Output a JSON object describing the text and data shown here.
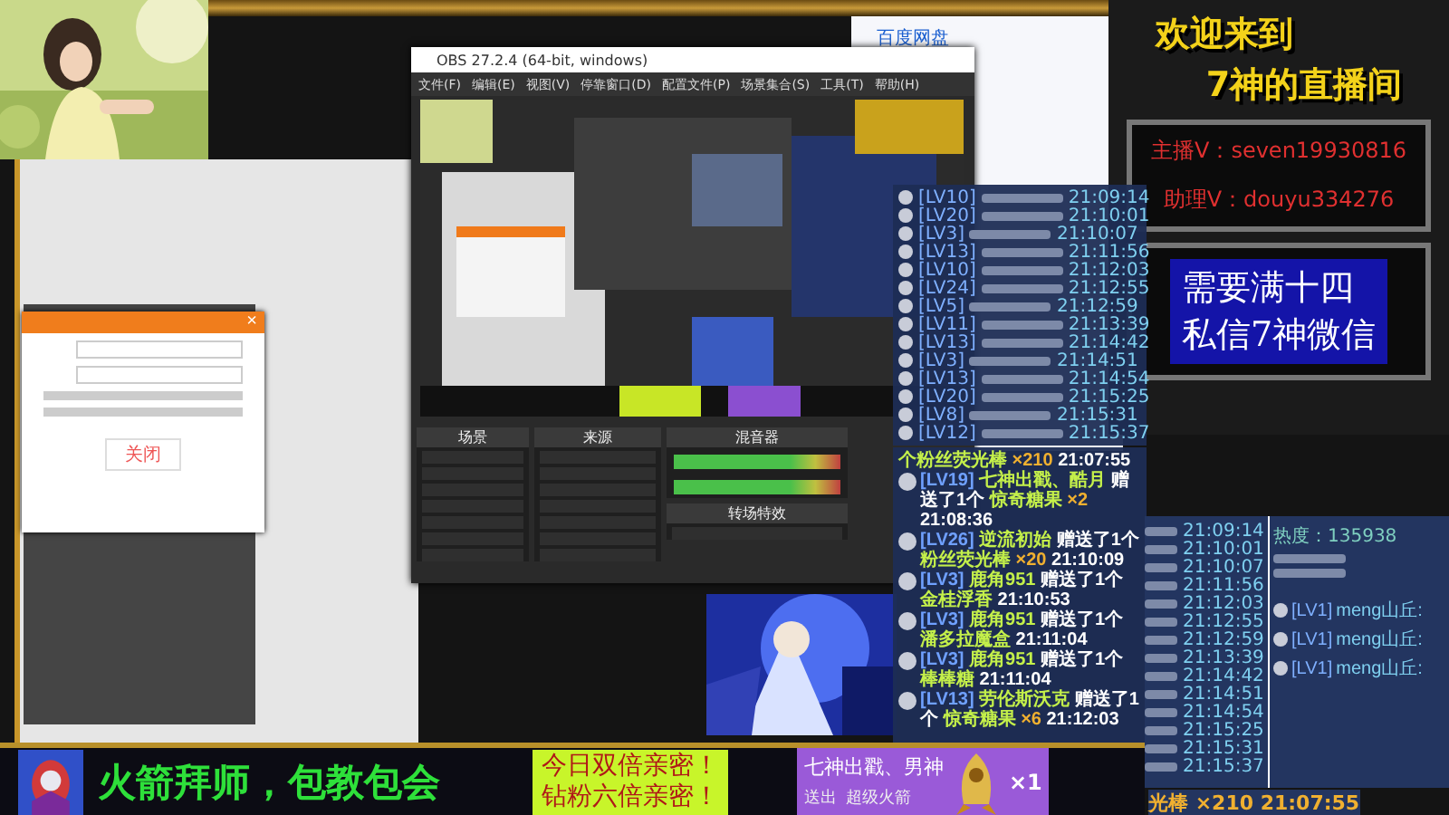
{
  "stream_overlay": {
    "welcome_title": [
      "欢迎来到",
      "7神的直播间"
    ],
    "contact_lines": [
      "主播V：seven19930816",
      "助理V：douyu334276"
    ],
    "notice_lines": [
      "需要满十四",
      "私信7神微信"
    ],
    "bottom_slogan": "火箭拜师，包教包会",
    "promo_lines": [
      "今日双倍亲密！",
      "钻粉六倍亲密！"
    ],
    "gift_toast": {
      "sender": "七神出戳、男神",
      "action": "送出",
      "gift": "超级火箭",
      "count": "×1"
    }
  },
  "browser_dialog": {
    "close": "×",
    "button": "关闭"
  },
  "netdisk_window": {
    "title": "百度网盘"
  },
  "obs_window": {
    "title": "OBS 27.2.4 (64-bit, windows)",
    "menu": [
      "文件(F)",
      "编辑(E)",
      "视图(V)",
      "停靠窗口(D)",
      "配置文件(P)",
      "场景集合(S)",
      "工具(T)",
      "帮助(H)"
    ],
    "docks": [
      "场景",
      "来源",
      "混音器",
      "转场特效"
    ]
  },
  "entry_chat": {
    "entries": [
      {
        "level": "[LV10]",
        "time": "21:09:14"
      },
      {
        "level": "[LV20]",
        "time": "21:10:01"
      },
      {
        "level": "[LV3]",
        "time": "21:10:07"
      },
      {
        "level": "[LV13]",
        "time": "21:11:56"
      },
      {
        "level": "[LV10]",
        "time": "21:12:03"
      },
      {
        "level": "[LV24]",
        "time": "21:12:55"
      },
      {
        "level": "[LV5]",
        "time": "21:12:59"
      },
      {
        "level": "[LV11]",
        "time": "21:13:39"
      },
      {
        "level": "[LV13]",
        "time": "21:14:42"
      },
      {
        "level": "[LV3]",
        "time": "21:14:51"
      },
      {
        "level": "[LV13]",
        "time": "21:14:54"
      },
      {
        "level": "[LV20]",
        "time": "21:15:25"
      },
      {
        "level": "[LV8]",
        "time": "21:15:31"
      },
      {
        "level": "[LV12]",
        "time": "21:15:37"
      }
    ]
  },
  "gift_chat": {
    "messages": [
      {
        "segments": [
          {
            "kind": "gift",
            "text": "个粉丝荧光棒"
          },
          {
            "kind": "count",
            "text": "×210"
          },
          {
            "kind": "time",
            "text": "21:07:55"
          }
        ]
      },
      {
        "segments": [
          {
            "kind": "level",
            "text": "[LV19]"
          },
          {
            "kind": "user",
            "text": "七神出戳、酷月"
          },
          {
            "kind": "plain",
            "text": "赠送了1个"
          },
          {
            "kind": "gift",
            "text": "惊奇糖果"
          },
          {
            "kind": "count",
            "text": "×2"
          },
          {
            "kind": "time",
            "text": "21:08:36"
          }
        ]
      },
      {
        "segments": [
          {
            "kind": "level",
            "text": "[LV26]"
          },
          {
            "kind": "user",
            "text": "逆流初始"
          },
          {
            "kind": "plain",
            "text": "赠送了1个"
          },
          {
            "kind": "gift",
            "text": "粉丝荧光棒"
          },
          {
            "kind": "count",
            "text": "×20"
          },
          {
            "kind": "time",
            "text": "21:10:09"
          }
        ]
      },
      {
        "segments": [
          {
            "kind": "level",
            "text": "[LV3]"
          },
          {
            "kind": "user",
            "text": "鹿角951"
          },
          {
            "kind": "plain",
            "text": "赠送了1个"
          },
          {
            "kind": "gift",
            "text": "金桂浮香"
          },
          {
            "kind": "time",
            "text": "21:10:53"
          }
        ]
      },
      {
        "segments": [
          {
            "kind": "level",
            "text": "[LV3]"
          },
          {
            "kind": "user",
            "text": "鹿角951"
          },
          {
            "kind": "plain",
            "text": "赠送了1个"
          },
          {
            "kind": "gift",
            "text": "潘多拉魔盒"
          },
          {
            "kind": "time",
            "text": "21:11:04"
          }
        ]
      },
      {
        "segments": [
          {
            "kind": "level",
            "text": "[LV3]"
          },
          {
            "kind": "user",
            "text": "鹿角951"
          },
          {
            "kind": "plain",
            "text": "赠送了1个"
          },
          {
            "kind": "gift",
            "text": "棒棒糖"
          },
          {
            "kind": "time",
            "text": "21:11:04"
          }
        ]
      },
      {
        "segments": [
          {
            "kind": "level",
            "text": "[LV13]"
          },
          {
            "kind": "user",
            "text": "劳伦斯沃克"
          },
          {
            "kind": "plain",
            "text": "赠送了1个"
          },
          {
            "kind": "gift",
            "text": "惊奇糖果"
          },
          {
            "kind": "count",
            "text": "×6"
          },
          {
            "kind": "time",
            "text": "21:12:03"
          }
        ]
      }
    ]
  },
  "side_chat": {
    "stats": [
      "热度：135938"
    ],
    "times": [
      "21:09:14",
      "21:10:01",
      "21:10:07",
      "21:11:56",
      "21:12:03",
      "21:12:55",
      "21:12:59",
      "21:13:39",
      "21:14:42",
      "21:14:51",
      "21:14:54",
      "21:15:25",
      "21:15:31",
      "21:15:37"
    ],
    "comments": [
      {
        "level": "[LV1]",
        "user": "meng山丘:"
      },
      {
        "level": "[LV1]",
        "user": "meng山丘:"
      },
      {
        "level": "[LV1]",
        "user": "meng山丘:"
      }
    ],
    "last_line": "光棒 ×210 21:07:55"
  }
}
